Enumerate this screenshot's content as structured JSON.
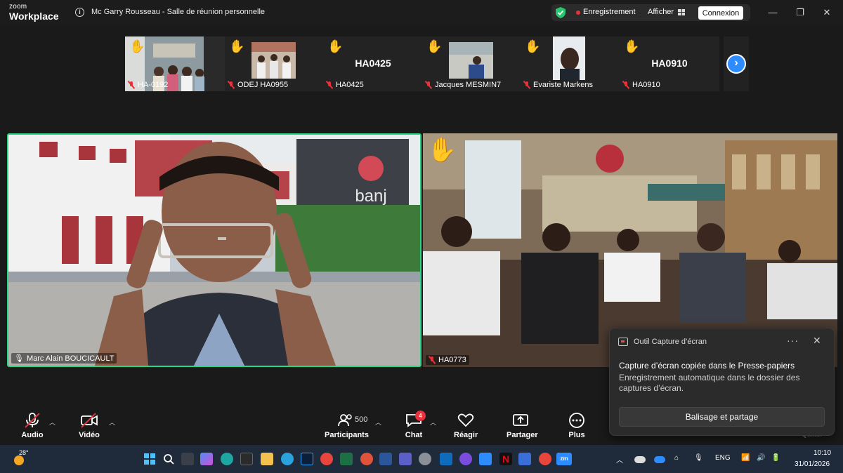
{
  "app": {
    "logo_line1": "zoom",
    "logo_line2": "Workplace"
  },
  "meeting": {
    "title": "Mc Garry Rousseau - Salle de réunion personnelle"
  },
  "titlebar": {
    "recording_label": "Enregistrement",
    "view_label": "Afficher",
    "connect_label": "Connexion"
  },
  "thumbnails": [
    {
      "name": "HA-0192",
      "hand": true,
      "video": true
    },
    {
      "name": "ODEJ HA0955",
      "hand": true,
      "video": true
    },
    {
      "name": "HA0425",
      "hand": true,
      "video": false,
      "display_name": "HA0425"
    },
    {
      "name": "Jacques MESMIN7",
      "hand": true,
      "video": true
    },
    {
      "name": "Evariste Markens",
      "hand": true,
      "video": true
    },
    {
      "name": "HA0910",
      "hand": true,
      "video": false,
      "display_name": "HA0910"
    }
  ],
  "main_tiles": {
    "left": {
      "name": "Marc Alain BOUCICAULT",
      "sign_text": "banj"
    },
    "right": {
      "name": "HA0773"
    }
  },
  "toast": {
    "app_name": "Outil Capture d’écran",
    "title": "Capture d’écran copiée dans le Presse-papiers",
    "body": "Enregistrement automatique dans le dossier des captures d’écran.",
    "action_label": "Balisage et partage"
  },
  "toolbar": {
    "audio_label": "Audio",
    "video_label": "Vidéo",
    "participants_label": "Participants",
    "participants_count": "500",
    "chat_label": "Chat",
    "chat_badge": "4",
    "react_label": "Réagir",
    "share_label": "Partager",
    "more_label": "Plus",
    "quit_label": "Quitter"
  },
  "taskbar": {
    "temperature": "28°",
    "language": "ENG",
    "time": "10:10",
    "date": "31/01/2026"
  },
  "colors": {
    "active_speaker": "#28d785",
    "recording": "#e8313a",
    "accent": "#2d8cff"
  }
}
